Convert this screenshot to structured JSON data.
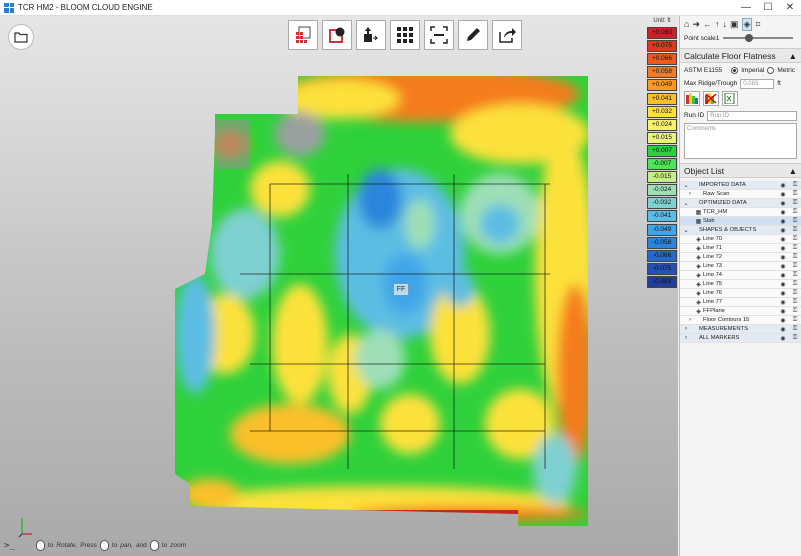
{
  "window": {
    "title": "TCR HM2 - BLOOM CLOUD ENGINE",
    "minimize": "—",
    "maximize": "☐",
    "close": "✕"
  },
  "viewport": {
    "ff_label": "FF",
    "status": {
      "prompt": ">_",
      "part1": "to",
      "rotate": "Rotate,",
      "part2": "Press",
      "part3": "to",
      "pan": "pan,",
      "part4": "and",
      "part5": "to",
      "zoom": "zoom"
    }
  },
  "legend": {
    "unit": "Unit: ft",
    "items": [
      {
        "value": "+0.083",
        "color": "#c7252a"
      },
      {
        "value": "+0.075",
        "color": "#db3a22"
      },
      {
        "value": "+0.066",
        "color": "#ec5a1e"
      },
      {
        "value": "+0.058",
        "color": "#f47b1f"
      },
      {
        "value": "+0.049",
        "color": "#f89a22"
      },
      {
        "value": "+0.041",
        "color": "#fbbf2a"
      },
      {
        "value": "+0.032",
        "color": "#fde13a"
      },
      {
        "value": "+0.024",
        "color": "#f6f06b"
      },
      {
        "value": "+0.015",
        "color": "#e9f57a"
      },
      {
        "value": "+0.007",
        "color": "#2bd43a"
      },
      {
        "value": "-0.007",
        "color": "#4ee35b"
      },
      {
        "value": "-0.015",
        "color": "#c6ec8c"
      },
      {
        "value": "-0.024",
        "color": "#9edfb8"
      },
      {
        "value": "-0.032",
        "color": "#7fd0d1"
      },
      {
        "value": "-0.041",
        "color": "#5bbde3"
      },
      {
        "value": "-0.049",
        "color": "#3fa5e6"
      },
      {
        "value": "-0.058",
        "color": "#2a86dc"
      },
      {
        "value": "-0.066",
        "color": "#256acb"
      },
      {
        "value": "-0.075",
        "color": "#2451b3"
      },
      {
        "value": "-0.083",
        "color": "#203e9a"
      }
    ]
  },
  "panel": {
    "point_scale_label": "Point scale",
    "point_scale_value": "1",
    "flatness": {
      "title": "Calculate Floor Flatness",
      "collapse": "▲",
      "standard": "ASTM E1155",
      "imperial": "Imperial",
      "metric": "Metric",
      "ridge_label": "Max Ridge/Trough",
      "ridge_placeholder": "0.083",
      "ridge_unit": "ft",
      "run_id_label": "Run ID",
      "run_id_placeholder": "Run ID",
      "comments_placeholder": "Comments"
    },
    "object_list": {
      "title": "Object List",
      "collapse": "▲",
      "items": [
        {
          "name": "IMPORTED DATA",
          "type": "group",
          "exp": "⌄",
          "icon": ""
        },
        {
          "name": "Raw Scan",
          "type": "child",
          "exp": "›",
          "icon": ""
        },
        {
          "name": "OPTIMIZED DATA",
          "type": "group",
          "exp": "⌄",
          "icon": ""
        },
        {
          "name": "TCR_HM",
          "type": "child",
          "exp": "",
          "icon": "▦"
        },
        {
          "name": "Slab",
          "type": "selected",
          "exp": "",
          "icon": "▦"
        },
        {
          "name": "SHAPES & OBJECTS",
          "type": "group",
          "exp": "⌄",
          "icon": ""
        },
        {
          "name": "Line 70",
          "type": "child",
          "exp": "",
          "icon": "◈"
        },
        {
          "name": "Line 71",
          "type": "child",
          "exp": "",
          "icon": "◈"
        },
        {
          "name": "Line 72",
          "type": "child",
          "exp": "",
          "icon": "◈"
        },
        {
          "name": "Line 73",
          "type": "child",
          "exp": "",
          "icon": "◈"
        },
        {
          "name": "Line 74",
          "type": "child",
          "exp": "",
          "icon": "◈"
        },
        {
          "name": "Line 75",
          "type": "child",
          "exp": "",
          "icon": "◈"
        },
        {
          "name": "Line 76",
          "type": "child",
          "exp": "",
          "icon": "◈"
        },
        {
          "name": "Line 77",
          "type": "child",
          "exp": "",
          "icon": "◈"
        },
        {
          "name": "FFPlane",
          "type": "child",
          "exp": "",
          "icon": "◈"
        },
        {
          "name": "Floor Contours 15",
          "type": "child",
          "exp": "›",
          "icon": ""
        },
        {
          "name": "MEASUREMENTS",
          "type": "group",
          "exp": "›",
          "icon": ""
        },
        {
          "name": "ALL MARKERS",
          "type": "group",
          "exp": "›",
          "icon": ""
        }
      ]
    }
  }
}
